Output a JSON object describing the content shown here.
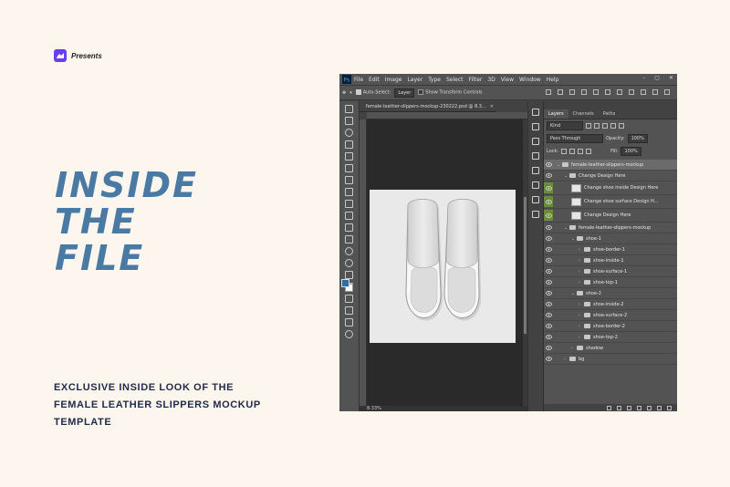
{
  "brand": {
    "label": "Presents"
  },
  "hero": {
    "lines": [
      "INSIDE",
      "THE",
      "FILE"
    ]
  },
  "subtitle": {
    "lines": [
      "EXCLUSIVE INSIDE LOOK OF THE",
      "FEMALE LEATHER SLIPPERS MOCKUP",
      "TEMPLATE"
    ]
  },
  "photoshop": {
    "menu": [
      "File",
      "Edit",
      "Image",
      "Layer",
      "Type",
      "Select",
      "Filter",
      "3D",
      "View",
      "Window",
      "Help"
    ],
    "options": {
      "auto_select": "Auto-Select:",
      "auto_select_target": "Layer",
      "show_transform": "Show Transform Controls"
    },
    "document_tab": "female-leather-slippers-mockup-230222.psd @ 8.3...",
    "zoom": "8.33%",
    "panel_tabs": [
      "Layers",
      "Channels",
      "Paths"
    ],
    "filter_kind": "Kind",
    "blend_mode": "Pass Through",
    "opacity_label": "Opacity:",
    "opacity_value": "100%",
    "lock_label": "Lock:",
    "fill_label": "Fill:",
    "fill_value": "100%",
    "layers": [
      {
        "name": "female-leather-slippers-mockup",
        "type": "group",
        "indent": 0,
        "selected": true
      },
      {
        "name": "Change Design Here",
        "type": "group",
        "indent": 1
      },
      {
        "name": "Change shoe inside Design Here",
        "type": "smart",
        "indent": 2,
        "green": true
      },
      {
        "name": "Change shoe surface Design H...",
        "type": "smart",
        "indent": 2,
        "green": true
      },
      {
        "name": "Change Design Here",
        "type": "smart",
        "indent": 2,
        "green": true
      },
      {
        "name": "female-leather-slippers-mockup",
        "type": "group",
        "indent": 1
      },
      {
        "name": "shoe-1",
        "type": "group",
        "indent": 2
      },
      {
        "name": "shoe-border-1",
        "type": "folder",
        "indent": 3
      },
      {
        "name": "shoe-inside-1",
        "type": "folder",
        "indent": 3
      },
      {
        "name": "shoe-surface-1",
        "type": "folder",
        "indent": 3
      },
      {
        "name": "shoe-top-1",
        "type": "folder",
        "indent": 3
      },
      {
        "name": "shoe-2",
        "type": "group",
        "indent": 2
      },
      {
        "name": "shoe-inside-2",
        "type": "folder",
        "indent": 3
      },
      {
        "name": "shoe-surface-2",
        "type": "folder",
        "indent": 3
      },
      {
        "name": "shoe-border-2",
        "type": "folder",
        "indent": 3
      },
      {
        "name": "shoe-top-2",
        "type": "folder",
        "indent": 3
      },
      {
        "name": "shadow",
        "type": "folder",
        "indent": 2
      },
      {
        "name": "bg",
        "type": "folder",
        "indent": 1
      }
    ]
  }
}
